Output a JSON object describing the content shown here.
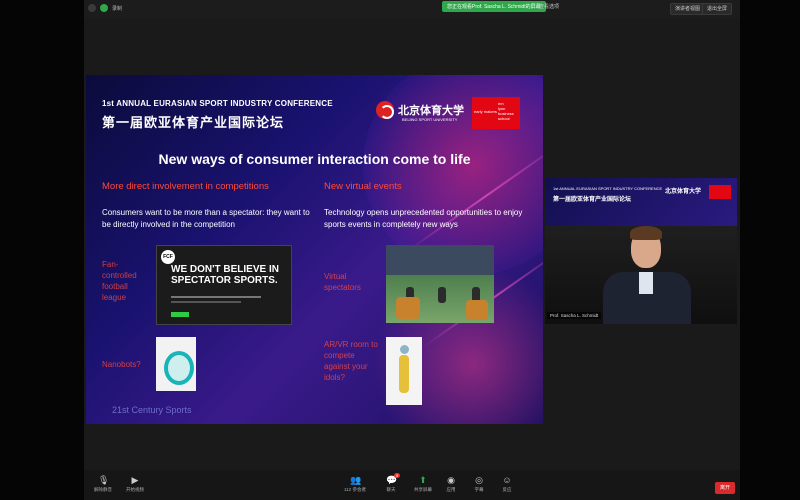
{
  "topbar": {
    "share_banner": "您正在观看Prof. Sascha L. Schmidt的屏幕",
    "view_options": "查看选项",
    "zoom_label": "",
    "btn_speaker_view": "演讲者视图",
    "btn_exit_fullscreen": "退出全屏"
  },
  "slide": {
    "conference_en": "1st ANNUAL EURASIAN SPORT INDUSTRY CONFERENCE",
    "conference_cn": "第一届欧亚体育产业国际论坛",
    "bsu_name": "北京体育大学",
    "bsu_sub": "BEIJING SPORT UNIVERSITY",
    "emlyon_lines": [
      "em",
      "lyon",
      "business",
      "school"
    ],
    "emlyon_left": "early makers",
    "title": "New ways of consumer interaction come to life",
    "left_heading": "More direct involvement in competitions",
    "left_body": "Consumers want to be more than a spectator: they want to be directly involved in the competition",
    "right_heading": "New virtual events",
    "right_body": "Technology opens unprecedented opportunities to enjoy sports events in completely new ways",
    "label_fan": "Fan-controlled football league",
    "label_nanobots": "Nanobots?",
    "label_virtual": "Virtual spectators",
    "label_arvr": "AR/VR room to compete against your idols?",
    "footer": "21st Century Sports",
    "site_logo": "FCF",
    "site_headline": "WE DON'T BELIEVE IN SPECTATOR SPORTS."
  },
  "camera": {
    "slide_en": "1st ANNUAL EURASIAN SPORT INDUSTRY CONFERENCE",
    "slide_cn": "第一届欧亚体育产业国际论坛",
    "slide_logo": "北京体育大学",
    "name": "Prof. Sascha L. Schmidt"
  },
  "bottombar": {
    "items": [
      {
        "label": "解除静音",
        "icon": "mic-icon"
      },
      {
        "label": "开始视频",
        "icon": "video-icon"
      },
      {
        "label": "参会者",
        "icon": "participants-icon",
        "count": "112"
      },
      {
        "label": "聊天",
        "icon": "chat-icon",
        "badge": "9"
      },
      {
        "label": "共享屏幕",
        "icon": "share-icon"
      },
      {
        "label": "应用",
        "icon": "apps-icon"
      },
      {
        "label": "字幕",
        "icon": "cc-icon"
      },
      {
        "label": "反应",
        "icon": "reaction-icon"
      }
    ],
    "end": "离开"
  }
}
